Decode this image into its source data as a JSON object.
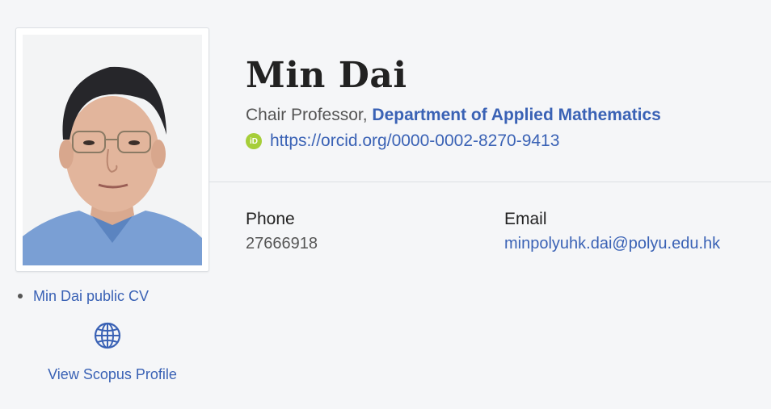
{
  "profile": {
    "name": "Min Dai",
    "role_prefix": "Chair Professor, ",
    "department": "Department of Applied Mathematics",
    "orcid_url": "https://orcid.org/0000-0002-8270-9413",
    "orcid_badge": "iD"
  },
  "contact": {
    "phone_label": "Phone",
    "phone_value": "27666918",
    "email_label": "Email",
    "email_value": "minpolyuhk.dai@polyu.edu.hk"
  },
  "sidebar": {
    "cv_link": "Min Dai public CV",
    "scopus_link": "View Scopus Profile",
    "globe_icon": "globe-icon"
  },
  "colors": {
    "link": "#3a62b5",
    "orcid": "#a6ce39",
    "background": "#f5f6f8"
  }
}
